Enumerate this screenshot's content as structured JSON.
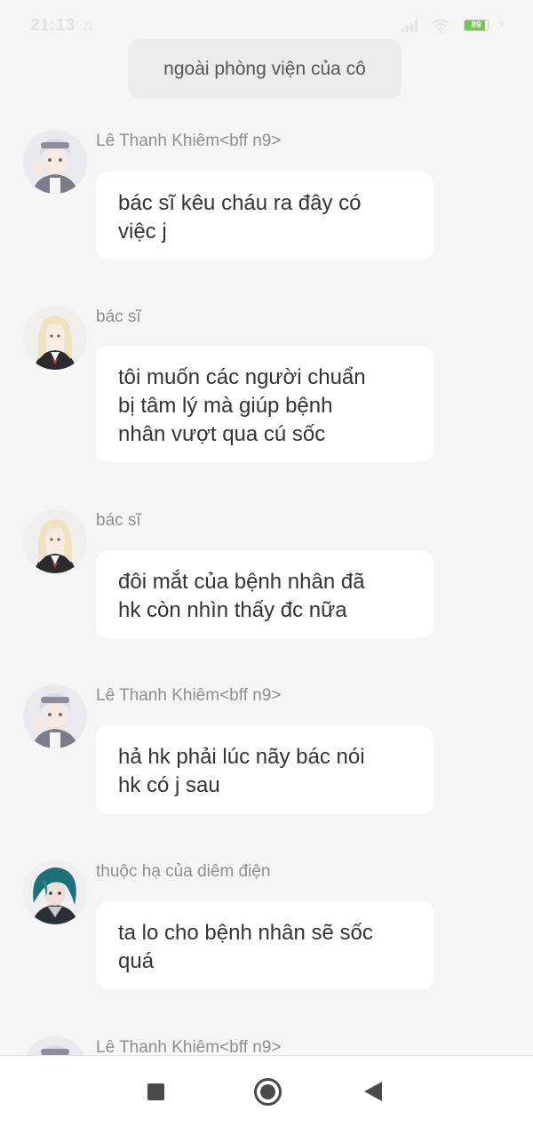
{
  "status_bar": {
    "time": "21:13",
    "battery": "89",
    "battery_level_percent": 89,
    "music_icon": "headphones-icon",
    "signal_icon": "cell-signal-icon",
    "wifi_icon": "wifi-icon",
    "charging_icon": "bolt-icon"
  },
  "narration": "ngoài phòng viện của cô",
  "messages": [
    {
      "sender": "Lê Thanh Khiêm<bff n9>",
      "avatar": "white-hair-boy-avatar",
      "lines": [
        "bác sĩ kêu cháu ra đây có",
        "việc j"
      ]
    },
    {
      "sender": "bác sĩ",
      "avatar": "blonde-doctor-avatar",
      "lines": [
        "tôi muốn các người chuẩn",
        "bị tâm lý mà giúp bệnh",
        "nhân vượt qua cú sốc"
      ]
    },
    {
      "sender": "bác sĩ",
      "avatar": "blonde-doctor-avatar",
      "lines": [
        "đôi mắt của bệnh nhân đã",
        "hk còn nhìn thấy đc nữa"
      ]
    },
    {
      "sender": "Lê Thanh Khiêm<bff n9>",
      "avatar": "white-hair-boy-avatar",
      "lines": [
        "hả hk phải lúc nãy bác nói",
        "hk có j sau"
      ]
    },
    {
      "sender": "thuộc hạ của diêm điện",
      "avatar": "teal-hair-man-avatar",
      "lines": [
        "ta lo cho bệnh nhân sẽ sốc",
        "quá"
      ]
    },
    {
      "sender": "Lê Thanh Khiêm<bff n9>",
      "avatar": "white-hair-boy-avatar",
      "lines": []
    }
  ],
  "nav_bar": {
    "recent_icon": "square-recent-apps-icon",
    "home_icon": "circle-home-icon",
    "back_icon": "triangle-back-icon"
  },
  "colors": {
    "background": "#f5f5f5",
    "bubble": "#ffffff",
    "narration_bubble": "#ececec",
    "sender_text": "#8e8e8e",
    "message_text": "#333333",
    "battery": "#71c94a"
  }
}
